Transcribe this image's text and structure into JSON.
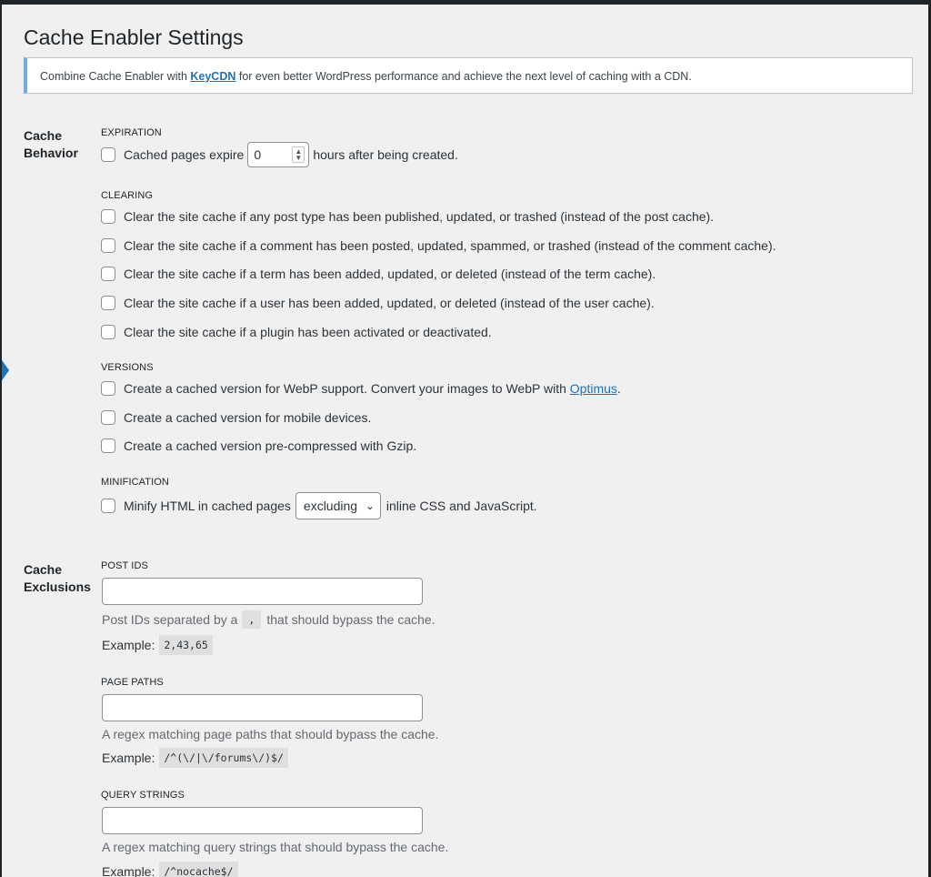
{
  "title": "Cache Enabler Settings",
  "notice": {
    "before": "Combine Cache Enabler with",
    "link": "KeyCDN",
    "after": "for even better WordPress performance and achieve the next level of caching with a CDN."
  },
  "cache_behavior": {
    "label_line1": "Cache",
    "label_line2": "Behavior",
    "expiration": {
      "title": "EXPIRATION",
      "before": "Cached pages expire",
      "value": "0",
      "after": "hours after being created."
    },
    "clearing": {
      "title": "CLEARING",
      "options": [
        "Clear the site cache if any post type has been published, updated, or trashed (instead of the post cache).",
        "Clear the site cache if a comment has been posted, updated, spammed, or trashed (instead of the comment cache).",
        "Clear the site cache if a term has been added, updated, or deleted (instead of the term cache).",
        "Clear the site cache if a user has been added, updated, or deleted (instead of the user cache).",
        "Clear the site cache if a plugin has been activated or deactivated."
      ]
    },
    "versions": {
      "title": "VERSIONS",
      "webp_before": "Create a cached version for WebP support. Convert your images to WebP with",
      "webp_link": "Optimus",
      "webp_after": ".",
      "mobile": "Create a cached version for mobile devices.",
      "gzip": "Create a cached version pre-compressed with Gzip."
    },
    "minification": {
      "title": "MINIFICATION",
      "before": "Minify HTML in cached pages",
      "select_value": "excluding",
      "after": "inline CSS and JavaScript."
    }
  },
  "cache_exclusions": {
    "label_line1": "Cache",
    "label_line2": "Exclusions",
    "post_ids": {
      "title": "POST IDS",
      "desc_before": "Post IDs separated by a",
      "desc_code": ",",
      "desc_after": "that should bypass the cache.",
      "example_label": "Example:",
      "example": "2,43,65"
    },
    "page_paths": {
      "title": "PAGE PATHS",
      "desc": "A regex matching page paths that should bypass the cache.",
      "example_label": "Example:",
      "example": "/^(\\/|\\/forums\\/)$/"
    },
    "query_strings": {
      "title": "QUERY STRINGS",
      "desc": "A regex matching query strings that should bypass the cache.",
      "example_label": "Example:",
      "example": "/^nocache$/"
    }
  },
  "colors": {
    "link": "#2271b1",
    "notice_border": "#72aee6",
    "background": "#f0f0f1"
  }
}
